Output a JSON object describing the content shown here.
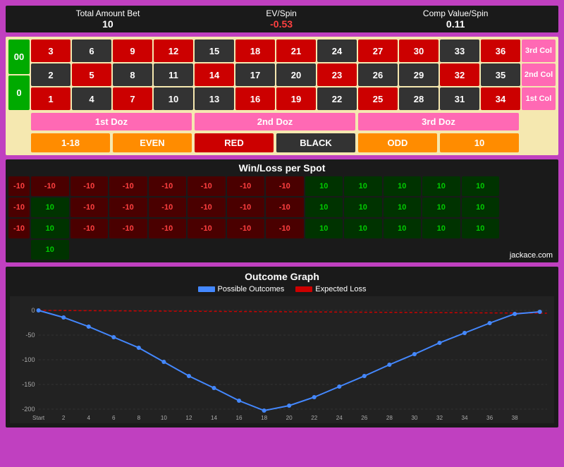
{
  "stats": {
    "total_amount_bet_label": "Total Amount Bet",
    "total_amount_bet_value": "10",
    "ev_spin_label": "EV/Spin",
    "ev_spin_value": "-0.53",
    "comp_value_label": "Comp Value/Spin",
    "comp_value_value": "0.11"
  },
  "roulette": {
    "zeros": [
      "00",
      "0"
    ],
    "columns": [
      "3rd Col",
      "2nd Col",
      "1st Col"
    ],
    "numbers": [
      {
        "n": "3",
        "c": "red"
      },
      {
        "n": "6",
        "c": "black"
      },
      {
        "n": "9",
        "c": "red"
      },
      {
        "n": "12",
        "c": "red"
      },
      {
        "n": "15",
        "c": "black"
      },
      {
        "n": "18",
        "c": "red"
      },
      {
        "n": "21",
        "c": "red"
      },
      {
        "n": "24",
        "c": "black"
      },
      {
        "n": "27",
        "c": "red"
      },
      {
        "n": "30",
        "c": "red"
      },
      {
        "n": "33",
        "c": "black"
      },
      {
        "n": "36",
        "c": "red"
      },
      {
        "n": "2",
        "c": "black"
      },
      {
        "n": "5",
        "c": "red"
      },
      {
        "n": "8",
        "c": "black"
      },
      {
        "n": "11",
        "c": "black"
      },
      {
        "n": "14",
        "c": "red"
      },
      {
        "n": "17",
        "c": "black"
      },
      {
        "n": "20",
        "c": "black"
      },
      {
        "n": "23",
        "c": "red"
      },
      {
        "n": "26",
        "c": "black"
      },
      {
        "n": "29",
        "c": "black"
      },
      {
        "n": "32",
        "c": "red"
      },
      {
        "n": "35",
        "c": "black"
      },
      {
        "n": "1",
        "c": "red"
      },
      {
        "n": "4",
        "c": "black"
      },
      {
        "n": "7",
        "c": "red"
      },
      {
        "n": "10",
        "c": "black"
      },
      {
        "n": "13",
        "c": "black"
      },
      {
        "n": "16",
        "c": "red"
      },
      {
        "n": "19",
        "c": "red"
      },
      {
        "n": "22",
        "c": "black"
      },
      {
        "n": "25",
        "c": "red"
      },
      {
        "n": "28",
        "c": "black"
      },
      {
        "n": "31",
        "c": "black"
      },
      {
        "n": "34",
        "c": "red"
      }
    ],
    "dozens": [
      "1st Doz",
      "2nd Doz",
      "3rd Doz"
    ],
    "outside": [
      "1-18",
      "EVEN",
      "RED",
      "BLACK",
      "ODD",
      "10"
    ]
  },
  "winloss": {
    "title": "Win/Loss per Spot",
    "left_col": [
      "-10",
      "-10",
      "-10"
    ],
    "cells": [
      "-10",
      "-10",
      "-10",
      "-10",
      "-10",
      "-10",
      "-10",
      "10",
      "10",
      "10",
      "10",
      "10",
      "10",
      "-10",
      "-10",
      "-10",
      "-10",
      "-10",
      "-10",
      "10",
      "10",
      "10",
      "10",
      "10",
      "10",
      "-10",
      "-10",
      "-10",
      "-10",
      "-10",
      "-10",
      "10",
      "10",
      "10",
      "10",
      "10",
      "10"
    ],
    "watermark": "jackace.com"
  },
  "graph": {
    "title": "Outcome Graph",
    "legend_possible": "Possible Outcomes",
    "legend_expected": "Expected Loss",
    "x_labels": [
      "Start",
      "2",
      "4",
      "6",
      "8",
      "10",
      "12",
      "14",
      "16",
      "18",
      "20",
      "22",
      "24",
      "26",
      "28",
      "30",
      "32",
      "34",
      "36",
      "38"
    ],
    "y_labels": [
      "0",
      "-50",
      "-100",
      "-150",
      "-200"
    ]
  }
}
